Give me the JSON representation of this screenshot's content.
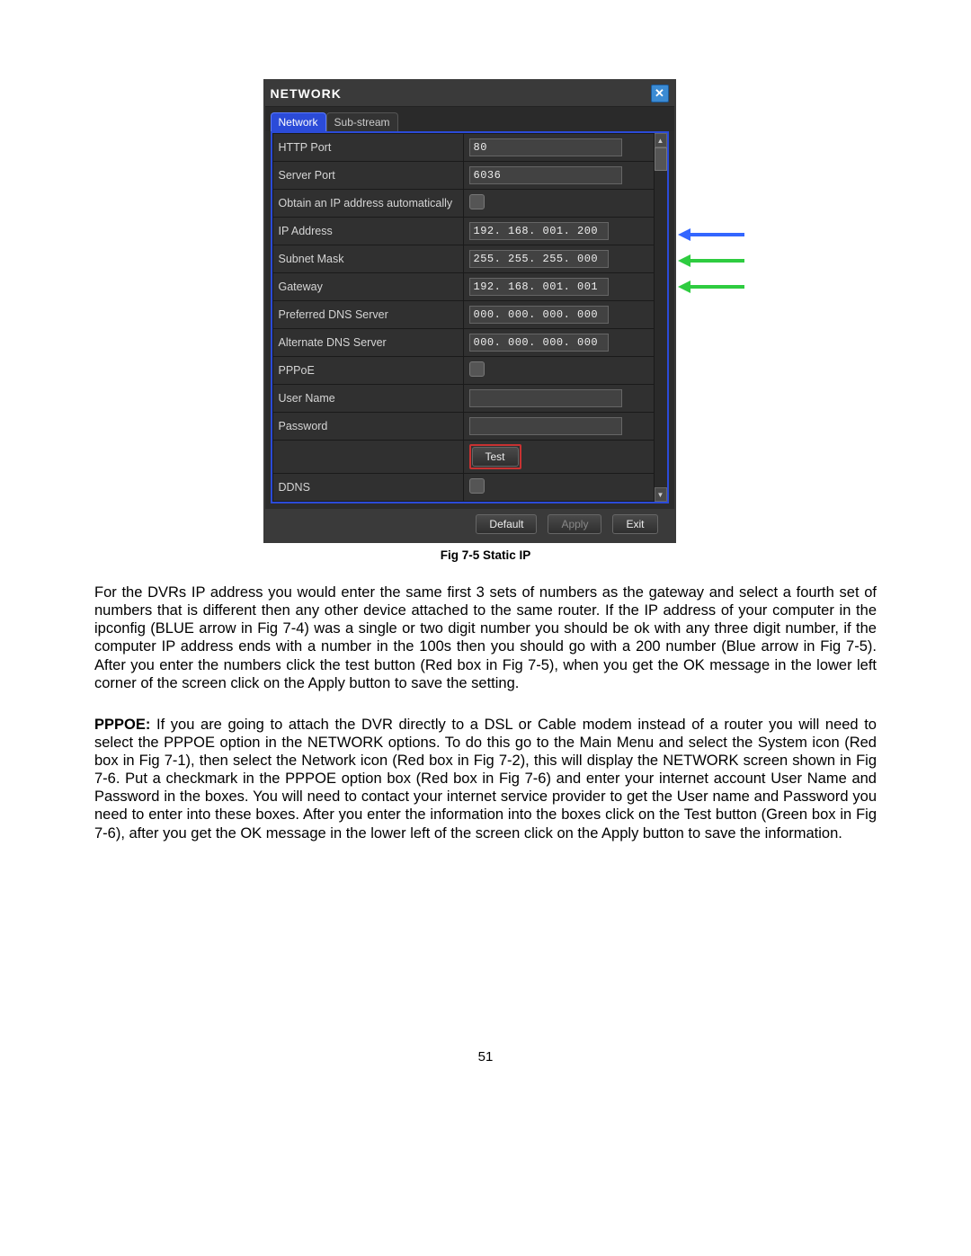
{
  "window": {
    "title": "NETWORK",
    "tabs": {
      "active": "Network",
      "inactive": "Sub-stream"
    },
    "rows": {
      "http_port": {
        "label": "HTTP Port",
        "value": "80"
      },
      "server_port": {
        "label": "Server Port",
        "value": "6036"
      },
      "auto_ip": {
        "label": "Obtain an IP address automatically"
      },
      "ip_address": {
        "label": "IP Address",
        "value": "192. 168. 001. 200"
      },
      "subnet_mask": {
        "label": "Subnet Mask",
        "value": "255. 255. 255. 000"
      },
      "gateway": {
        "label": "Gateway",
        "value": "192. 168. 001. 001"
      },
      "pref_dns": {
        "label": "Preferred DNS Server",
        "value": "000. 000. 000. 000"
      },
      "alt_dns": {
        "label": "Alternate DNS Server",
        "value": "000. 000. 000. 000"
      },
      "pppoe": {
        "label": "PPPoE"
      },
      "user_name": {
        "label": "User Name",
        "value": ""
      },
      "password": {
        "label": "Password",
        "value": ""
      },
      "test": {
        "label": "Test"
      },
      "ddns": {
        "label": "DDNS"
      }
    },
    "buttons": {
      "default": "Default",
      "apply": "Apply",
      "exit": "Exit"
    }
  },
  "caption": "Fig 7-5 Static IP",
  "para1": "For the DVRs IP address you would enter the same first 3 sets of numbers as the gateway and select a fourth set of numbers that is different then any other device attached to the same router. If the IP address of your computer in the ipconfig (BLUE arrow in Fig 7-4) was a single or two digit number you should be ok with any three digit number, if the computer IP address ends with a number in the 100s then you should go with a 200 number (Blue arrow in Fig 7-5). After you enter the numbers click the test button (Red box in Fig 7-5), when you get the OK message in the lower left corner of the screen click on the Apply button to save the setting.",
  "para2_prefix": "PPPOE:",
  "para2_rest": " If you are going to attach the DVR directly to a DSL or Cable modem instead of a router you will need to select the PPPOE option in the NETWORK options. To do this go to the Main Menu and select the System icon (Red box in Fig 7-1), then select the Network icon (Red box in Fig 7-2), this will display the NETWORK screen shown in Fig 7-6. Put a checkmark in the PPPOE option box (Red box in Fig 7-6) and enter your internet account User Name and Password in the boxes.  You will need to contact your internet service provider to get the User name and Password you need to enter into these boxes. After you enter the information into the boxes click on the Test button (Green box in Fig 7-6), after you get the OK message in the lower left of the screen click on the Apply button to save the information.",
  "page_number": "51"
}
